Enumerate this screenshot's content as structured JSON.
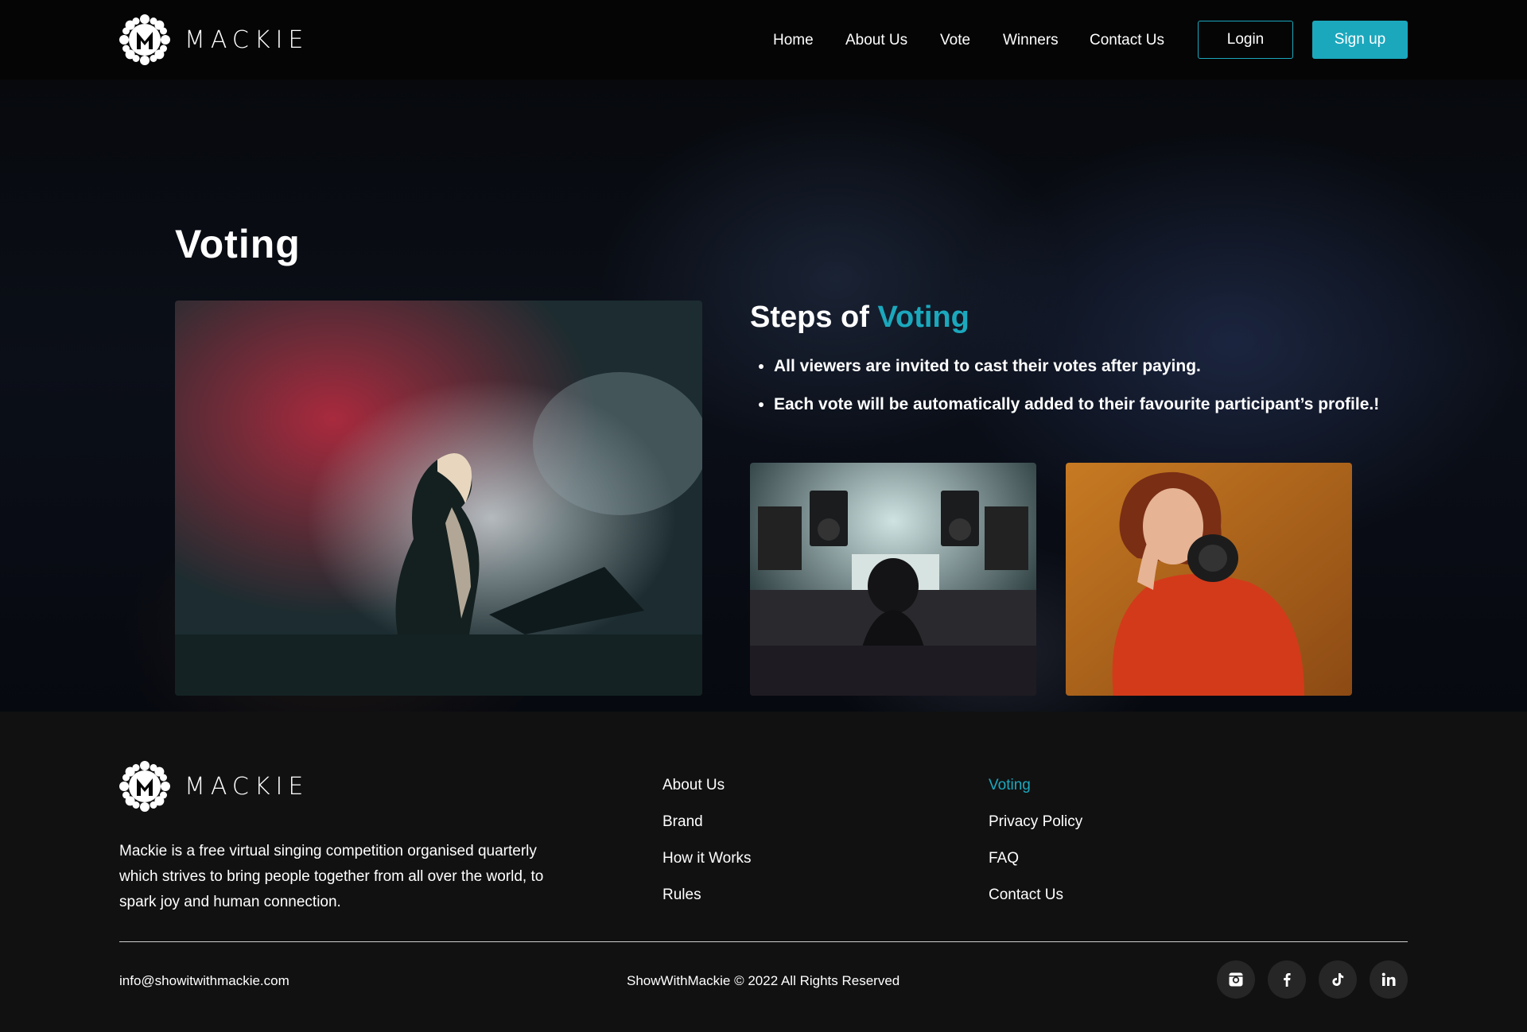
{
  "brand": {
    "name": "MACKIE",
    "accent_color": "#1ba8bd"
  },
  "nav": {
    "links": [
      "Home",
      "About Us",
      "Vote",
      "Winners",
      "Contact Us"
    ],
    "login_label": "Login",
    "signup_label": "Sign up"
  },
  "hero": {
    "title": "Voting",
    "steps_title_prefix": "Steps of",
    "steps_title_accent": "Voting",
    "steps": [
      "All viewers are invited to cast their votes after paying.",
      "Each vote will be automatically added to their favourite participant’s profile.!"
    ]
  },
  "footer": {
    "description": "Mackie is a free virtual singing competition organised quarterly which strives to bring people together from all over the world, to spark joy and human connection.",
    "column_1": [
      "About Us",
      "Brand",
      "How it Works",
      "Rules"
    ],
    "column_2": [
      "Voting",
      "Privacy Policy",
      "FAQ",
      "Contact Us"
    ],
    "email": "info@showitwithmackie.com",
    "copyright": "ShowWithMackie © 2022 All Rights Reserved",
    "socials": [
      "instagram-icon",
      "facebook-icon",
      "tiktok-icon",
      "linkedin-icon"
    ]
  }
}
